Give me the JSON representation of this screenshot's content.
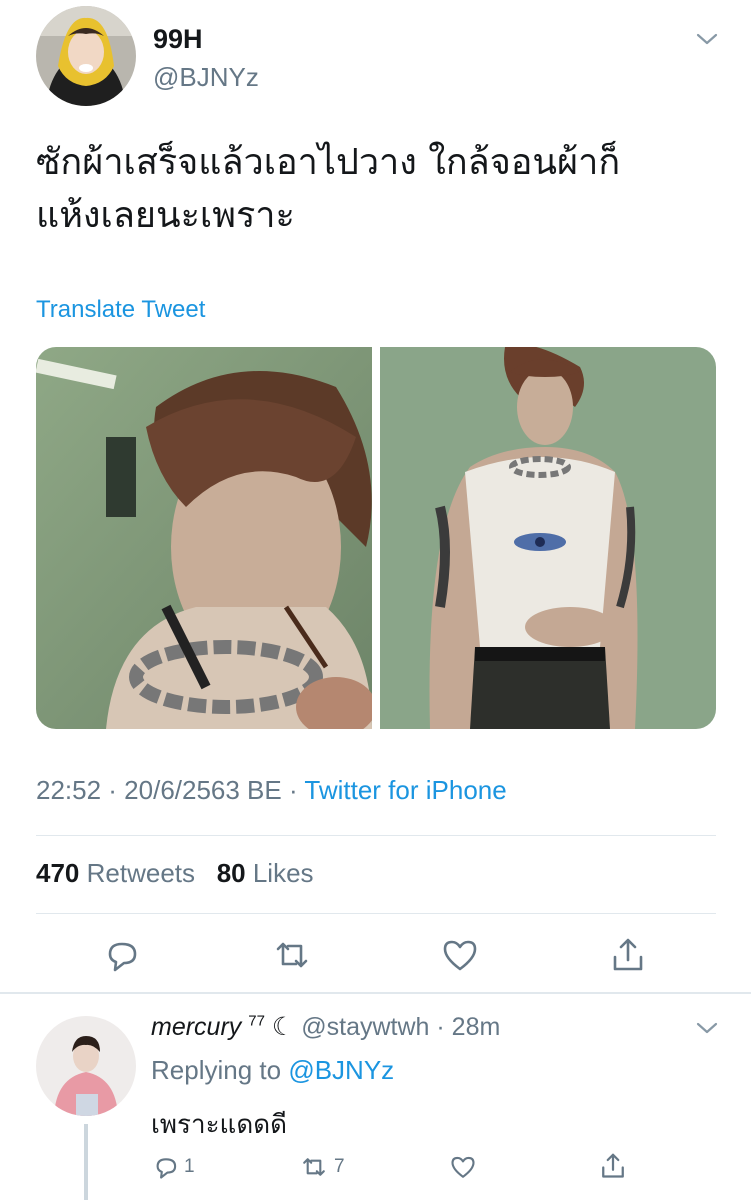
{
  "tweet": {
    "display_name": "99H",
    "handle": "@BJNYz",
    "text_line1": "ซักผ้าเสร็จแล้วเอาไปวาง ใกล้จอนผ้าก็",
    "text_line2": "แห้งเลยนะเพราะ",
    "translate_label": "Translate Tweet",
    "time": "22:52 · 20/6/2563 BE · ",
    "source": "Twitter for iPhone",
    "retweets_count": "470",
    "retweets_label": "Retweets",
    "likes_count": "80",
    "likes_label": "Likes"
  },
  "reply": {
    "name": "mercury",
    "name_sup": "77",
    "moon": "☾",
    "handle_time": "@staywtwh · 28m",
    "replying_prefix": "Replying to ",
    "replying_to": "@BJNYz",
    "text": "เพราะแดดดี",
    "reply_count": "1",
    "retweet_count": "7"
  },
  "colors": {
    "link": "#1b95e0",
    "secondary": "#657786",
    "photo_bg": "#8aa589"
  },
  "icons": [
    "chevron-down-icon",
    "reply-icon",
    "retweet-icon",
    "like-icon",
    "share-icon",
    "moon-icon"
  ]
}
